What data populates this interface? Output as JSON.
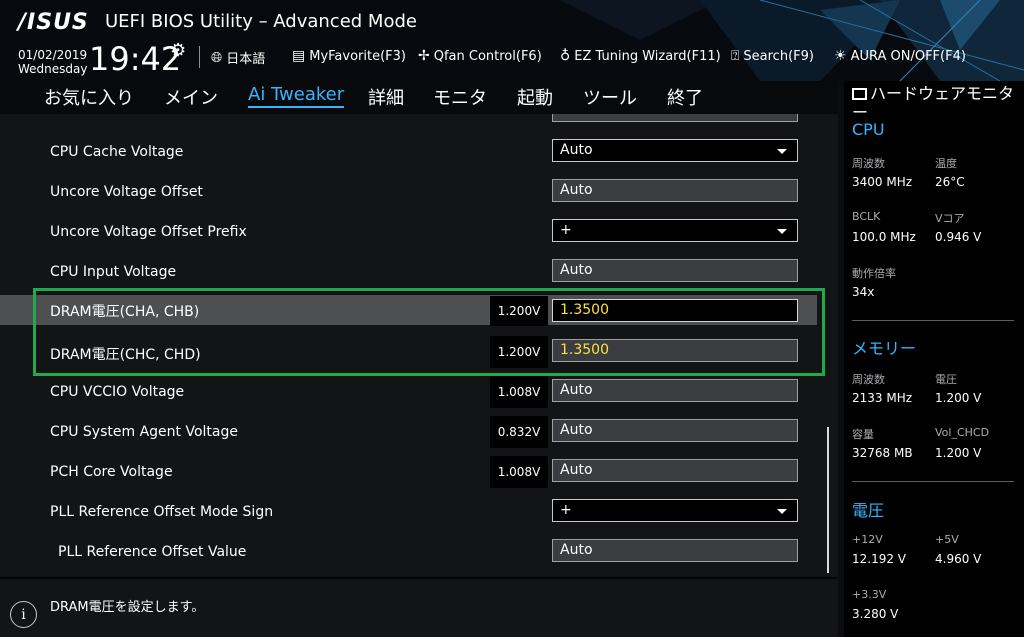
{
  "header": {
    "logo": "/ISUS",
    "title": "UEFI BIOS Utility – Advanced Mode",
    "date": "01/02/2019",
    "weekday": "Wednesday",
    "time": "19:42",
    "items": [
      {
        "icon": "globe-icon",
        "label": "日本語"
      },
      {
        "icon": "favorite-icon",
        "label": "MyFavorite(F3)"
      },
      {
        "icon": "fan-icon",
        "label": "Qfan Control(F6)"
      },
      {
        "icon": "bulb-icon",
        "label": "EZ Tuning Wizard(F11)"
      },
      {
        "icon": "search-icon",
        "label": "Search(F9)"
      },
      {
        "icon": "aura-icon",
        "label": "AURA ON/OFF(F4)"
      }
    ]
  },
  "tabs": [
    "お気に入り",
    "メイン",
    "Ai Tweaker",
    "詳細",
    "モニタ",
    "起動",
    "ツール",
    "終了"
  ],
  "active_tab": "Ai Tweaker",
  "settings": [
    {
      "label": "CPU Cache Voltage",
      "type": "select",
      "value": "Auto"
    },
    {
      "label": "Uncore Voltage Offset",
      "type": "field",
      "value": "Auto"
    },
    {
      "label": "Uncore Voltage Offset Prefix",
      "type": "select",
      "value": "+"
    },
    {
      "label": "CPU Input Voltage",
      "type": "field",
      "value": "Auto"
    },
    {
      "label": "DRAM電圧(CHA, CHB)",
      "type": "field",
      "current": "1.200V",
      "value": "1.3500",
      "highlighted": true
    },
    {
      "label": "DRAM電圧(CHC, CHD)",
      "type": "field",
      "current": "1.200V",
      "value": "1.3500"
    },
    {
      "label": "CPU VCCIO Voltage",
      "type": "field",
      "current": "1.008V",
      "value": "Auto"
    },
    {
      "label": "CPU System Agent Voltage",
      "type": "field",
      "current": "0.832V",
      "value": "Auto"
    },
    {
      "label": "PCH Core Voltage",
      "type": "field",
      "current": "1.008V",
      "value": "Auto"
    },
    {
      "label": "PLL Reference Offset Mode Sign",
      "type": "select",
      "value": "+"
    },
    {
      "label": "PLL Reference Offset Value",
      "type": "field",
      "value": "Auto"
    }
  ],
  "help_text": "DRAM電圧を設定します。",
  "hw_monitor": {
    "title": "ハードウェアモニター",
    "cpu": {
      "heading": "CPU",
      "freq_label": "周波数",
      "freq": "3400 MHz",
      "temp_label": "温度",
      "temp": "26°C",
      "bclk_label": "BCLK",
      "bclk": "100.0 MHz",
      "vcore_label": "Vコア",
      "vcore": "0.946 V",
      "ratio_label": "動作倍率",
      "ratio": "34x"
    },
    "memory": {
      "heading": "メモリー",
      "freq_label": "周波数",
      "freq": "2133 MHz",
      "volt_label": "電圧",
      "volt": "1.200 V",
      "cap_label": "容量",
      "cap": "32768 MB",
      "vol_chcd_label": "Vol_CHCD",
      "vol_chcd": "1.200 V"
    },
    "voltage": {
      "heading": "電圧",
      "v12_label": "+12V",
      "v12": "12.192 V",
      "v5_label": "+5V",
      "v5": "4.960 V",
      "v33_label": "+3.3V",
      "v33": "3.280 V"
    }
  }
}
